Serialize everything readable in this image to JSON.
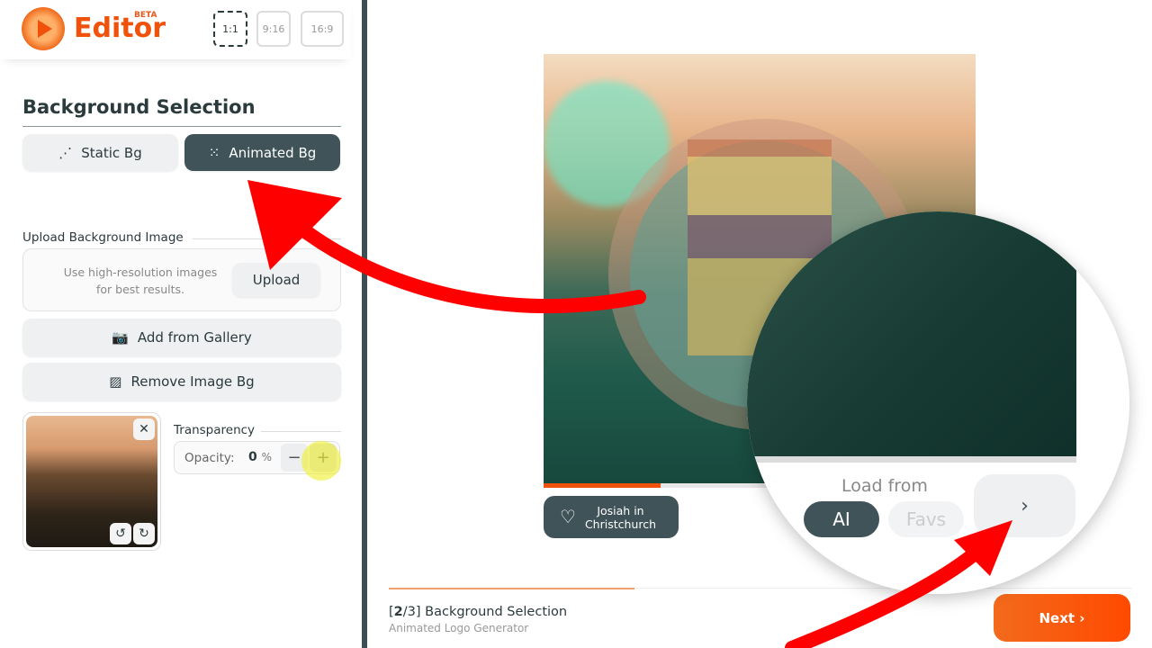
{
  "header": {
    "brand": "Editor",
    "badge": "BETA",
    "ratios": [
      {
        "label": "1:1",
        "active": true
      },
      {
        "label": "9:16",
        "active": false
      },
      {
        "label": "16:9",
        "active": false
      }
    ]
  },
  "section_title": "Background Selection",
  "bg_tabs": [
    {
      "label": "Static Bg",
      "icon": "static-bg-icon",
      "active": false
    },
    {
      "label": "Animated Bg",
      "icon": "animated-bg-icon",
      "active": true
    }
  ],
  "upload": {
    "title": "Upload Background Image",
    "hint_line1": "Use high-resolution images",
    "hint_line2": "for best results.",
    "button": "Upload"
  },
  "gallery_button": "Add from Gallery",
  "remove_bg_button": "Remove Image Bg",
  "thumbnail": {
    "close": "✕",
    "rotate_left": "↺",
    "rotate_right": "↻"
  },
  "transparency": {
    "title": "Transparency",
    "label": "Opacity:",
    "value": "0",
    "unit": "%",
    "minus": "−",
    "plus": "+"
  },
  "preview": {
    "progress_percent": 27,
    "credit_line1": "Josiah in",
    "credit_line2": "Christchurch"
  },
  "magnifier": {
    "load_from": "Load from",
    "ai": "AI",
    "favs": "Favs",
    "next_arrow": "›"
  },
  "footer": {
    "step_current": "2",
    "step_total": "/3]",
    "step_open": "[",
    "step_title": " Background Selection",
    "subtitle": "Animated Logo Generator",
    "next": "Next ›",
    "progress_percent": 33
  },
  "colors": {
    "accent": "#f0520c",
    "dark": "#3f5358",
    "annotation": "#ff0000"
  }
}
